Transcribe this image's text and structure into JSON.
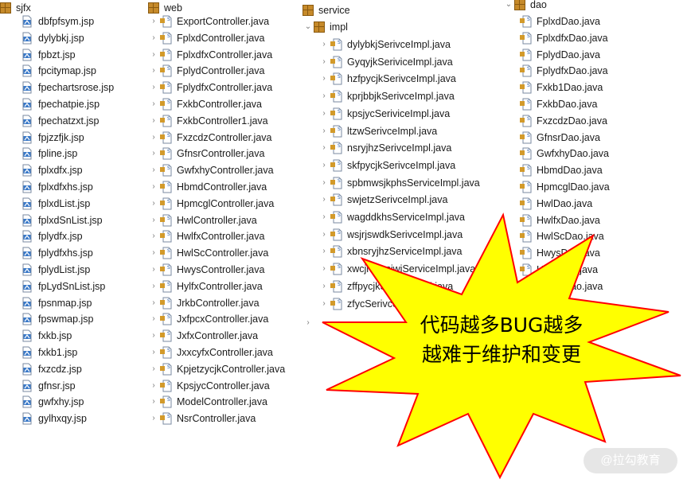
{
  "colors": {
    "burst_fill": "#ffff00",
    "burst_stroke": "#ff0000",
    "jsp_icon": "#3a79c8",
    "java_icon": "#d39a2a"
  },
  "tree": {
    "sjfx": {
      "label": "sjfx",
      "files": [
        "dbfpfsym.jsp",
        "dylybkj.jsp",
        "fpbzt.jsp",
        "fpcitymap.jsp",
        "fpechartsrose.jsp",
        "fpechatpie.jsp",
        "fpechatzxt.jsp",
        "fpjzzfjk.jsp",
        "fpline.jsp",
        "fplxdfx.jsp",
        "fplxdfxhs.jsp",
        "fplxdList.jsp",
        "fplxdSnList.jsp",
        "fplydfx.jsp",
        "fplydfxhs.jsp",
        "fplydList.jsp",
        "fpLydSnList.jsp",
        "fpsnmap.jsp",
        "fpswmap.jsp",
        "fxkb.jsp",
        "fxkb1.jsp",
        "fxzcdz.jsp",
        "gfnsr.jsp",
        "gwfxhy.jsp",
        "gylhxqy.jsp"
      ]
    },
    "web": {
      "label": "web",
      "files": [
        "ExportController.java",
        "FplxdController.java",
        "FplxdfxController.java",
        "FplydController.java",
        "FplydfxController.java",
        "FxkbController.java",
        "FxkbController1.java",
        "FxzcdzController.java",
        "GfnsrController.java",
        "GwfxhyController.java",
        "HbmdController.java",
        "HpmcglController.java",
        "HwlController.java",
        "HwlfxController.java",
        "HwlScController.java",
        "HwysController.java",
        "HylfxController.java",
        "JrkbController.java",
        "JxfpcxController.java",
        "JxfxController.java",
        "JxxcyfxController.java",
        "KpjetzycjkController.java",
        "KpsjycController.java",
        "ModelController.java",
        "NsrController.java"
      ]
    },
    "service": {
      "label": "service",
      "impl_label": "impl",
      "impl_files": [
        "dylybkjSerivceImpl.java",
        "GyqyjkSeriviceImpl.java",
        "hzfpycjkSerivceImpl.java",
        "kprjbbjkSerivceImpl.java",
        "kpsjycSeriviceImpl.java",
        "ltzwSerivceImpl.java",
        "nsryjhzSerivceImpl.java",
        "skfpycjkSerivceImpl.java",
        "spbmwsjkphsServiceImpl.java",
        "swjetzSerivceImpl.java",
        "wagddkhsServiceImpl.java",
        "wsjrjswdkSerivceImpl.java",
        "xbnsryjhzServiceImpl.java",
        "xwcjhbmsjwjServiceImpl.java",
        "zffpycjkSerivceImpl.java",
        "zfycSerivceImpl.java"
      ]
    },
    "dao": {
      "label": "dao",
      "files": [
        "FplxdDao.java",
        "FplxdfxDao.java",
        "FplydDao.java",
        "FplydfxDao.java",
        "Fxkb1Dao.java",
        "FxkbDao.java",
        "FxzcdzDao.java",
        "GfnsrDao.java",
        "GwfxhyDao.java",
        "HbmdDao.java",
        "HpmcglDao.java",
        "HwlDao.java",
        "HwlfxDao.java",
        "HwlScDao.java",
        "HwysDao.java",
        "HylfxDao.java",
        "ModelDao.java"
      ]
    }
  },
  "callout": {
    "line1": "代码越多BUG越多",
    "line2": "越难于维护和变更"
  },
  "watermark": "@拉勾教育"
}
